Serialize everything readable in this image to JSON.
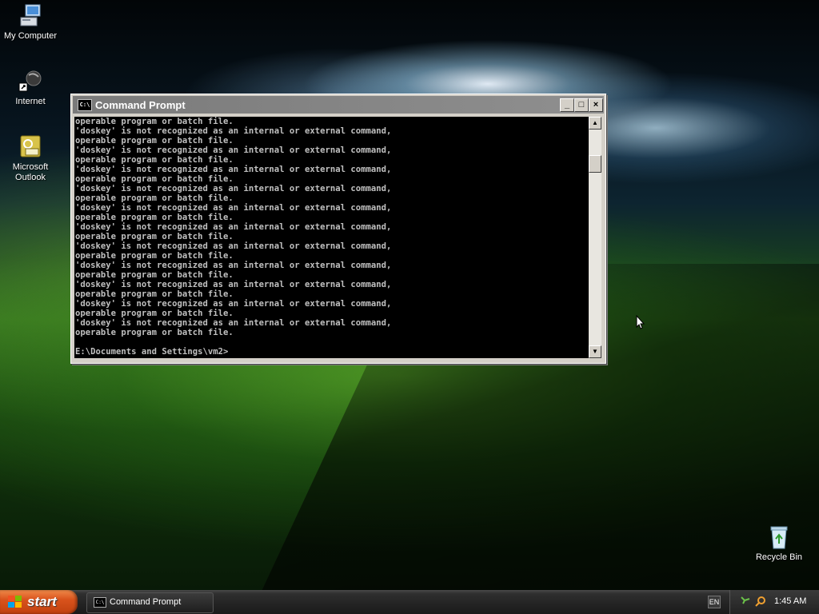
{
  "desktop": {
    "icons": [
      {
        "label": "My Computer",
        "icon": "my-computer-icon"
      },
      {
        "label": "Internet",
        "icon": "internet-icon"
      },
      {
        "label": "Microsoft Outlook",
        "icon": "outlook-icon"
      },
      {
        "label": "Recycle Bin",
        "icon": "recycle-bin-icon"
      }
    ]
  },
  "window": {
    "title": "Command Prompt",
    "buttons": {
      "minimize": "_",
      "maximize": "□",
      "close": "×"
    },
    "console_lines": [
      "operable program or batch file.",
      "'doskey' is not recognized as an internal or external command,",
      "operable program or batch file.",
      "'doskey' is not recognized as an internal or external command,",
      "operable program or batch file.",
      "'doskey' is not recognized as an internal or external command,",
      "operable program or batch file.",
      "'doskey' is not recognized as an internal or external command,",
      "operable program or batch file.",
      "'doskey' is not recognized as an internal or external command,",
      "operable program or batch file.",
      "'doskey' is not recognized as an internal or external command,",
      "operable program or batch file.",
      "'doskey' is not recognized as an internal or external command,",
      "operable program or batch file.",
      "'doskey' is not recognized as an internal or external command,",
      "operable program or batch file.",
      "'doskey' is not recognized as an internal or external command,",
      "operable program or batch file.",
      "'doskey' is not recognized as an internal or external command,",
      "operable program or batch file.",
      "'doskey' is not recognized as an internal or external command,",
      "operable program or batch file.",
      "",
      "E:\\Documents and Settings\\vm2>"
    ]
  },
  "taskbar": {
    "start_label": "start",
    "task_label": "Command Prompt",
    "lang": "EN",
    "clock": "1:45 AM"
  },
  "colors": {
    "console_bg": "#000000",
    "console_fg": "#c0c0c0",
    "start_orange": "#d9531c"
  }
}
